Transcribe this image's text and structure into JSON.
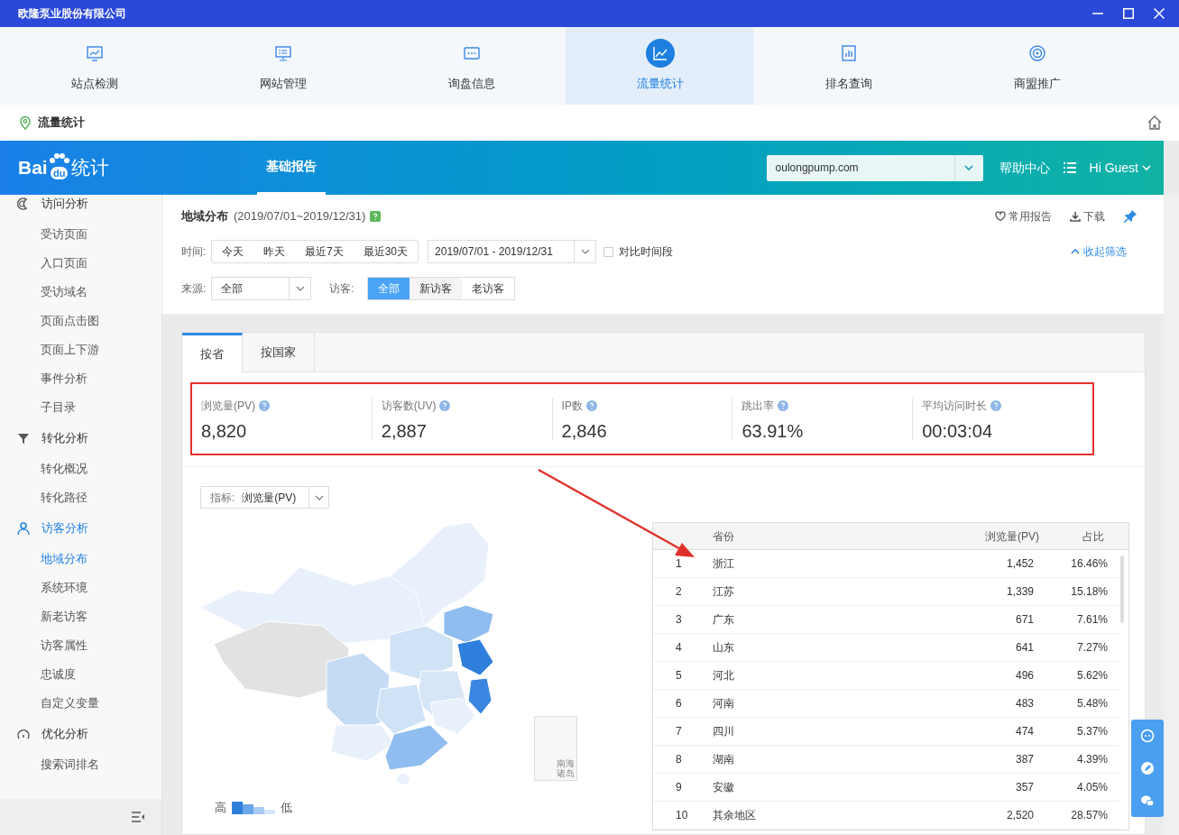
{
  "window": {
    "title": "欧隆泵业股份有限公司"
  },
  "nav_tabs": [
    {
      "label": "站点检测",
      "selected": false
    },
    {
      "label": "网站管理",
      "selected": false
    },
    {
      "label": "询盘信息",
      "selected": false
    },
    {
      "label": "流量统计",
      "selected": true
    },
    {
      "label": "排名查询",
      "selected": false
    },
    {
      "label": "商盟推广",
      "selected": false
    }
  ],
  "breadcrumb": "流量统计",
  "header": {
    "logo": {
      "left": "Bai",
      "paw": "du",
      "right": "统计"
    },
    "tabs": [
      {
        "label": "基础报告",
        "selected": true
      }
    ],
    "site_select": "oulongpump.com",
    "help": "帮助中心",
    "user": "Hi Guest"
  },
  "sidebar": {
    "groups": [
      {
        "label": "访问分析",
        "selected": false,
        "children": [
          {
            "label": "受访页面",
            "selected": false
          },
          {
            "label": "入口页面",
            "selected": false
          },
          {
            "label": "受访域名",
            "selected": false
          },
          {
            "label": "页面点击图",
            "selected": false
          },
          {
            "label": "页面上下游",
            "selected": false
          },
          {
            "label": "事件分析",
            "selected": false
          },
          {
            "label": "子目录",
            "selected": false
          }
        ]
      },
      {
        "label": "转化分析",
        "selected": false,
        "children": [
          {
            "label": "转化概况",
            "selected": false
          },
          {
            "label": "转化路径",
            "selected": false
          }
        ]
      },
      {
        "label": "访客分析",
        "selected": true,
        "children": [
          {
            "label": "地域分布",
            "selected": true
          },
          {
            "label": "系统环境",
            "selected": false
          },
          {
            "label": "新老访客",
            "selected": false
          },
          {
            "label": "访客属性",
            "selected": false
          },
          {
            "label": "忠诚度",
            "selected": false
          },
          {
            "label": "自定义变量",
            "selected": false
          }
        ]
      },
      {
        "label": "优化分析",
        "selected": false,
        "children": [
          {
            "label": "搜索词排名",
            "selected": false
          }
        ]
      }
    ]
  },
  "report": {
    "title": "地域分布",
    "date_range": "(2019/07/01~2019/12/31)",
    "actions": [
      "常用报告",
      "下载"
    ],
    "time_label": "时间:",
    "time_buttons": [
      "今天",
      "昨天",
      "最近7天",
      "最近30天"
    ],
    "date_input": "2019/07/01 - 2019/12/31",
    "compare": {
      "label": "对比时间段",
      "checked": false
    },
    "collapse": "收起筛选",
    "source_label": "来源:",
    "source_select": "全部",
    "visitor_label": "访客:",
    "visitor_buttons": [
      {
        "label": "全部",
        "selected": true
      },
      {
        "label": "新访客",
        "selected": false
      },
      {
        "label": "老访客",
        "selected": false
      }
    ]
  },
  "region_tabs": [
    {
      "label": "按省",
      "selected": true
    },
    {
      "label": "按国家",
      "selected": false
    }
  ],
  "metrics": [
    {
      "label": "浏览量(PV)",
      "value": "8,820"
    },
    {
      "label": "访客数(UV)",
      "value": "2,887"
    },
    {
      "label": "IP数",
      "value": "2,846"
    },
    {
      "label": "跳出率",
      "value": "63.91%"
    },
    {
      "label": "平均访问时长",
      "value": "00:03:04"
    }
  ],
  "indicator": {
    "label": "指标:",
    "value": "浏览量(PV)"
  },
  "map": {
    "inset_label": "南海诸岛",
    "legend_high": "高",
    "legend_low": "低"
  },
  "table": {
    "columns": [
      "省份",
      "浏览量(PV)",
      "占比"
    ],
    "rows": [
      {
        "rank": "1",
        "province": "浙江",
        "pv": "1,452",
        "share": "16.46%"
      },
      {
        "rank": "2",
        "province": "江苏",
        "pv": "1,339",
        "share": "15.18%"
      },
      {
        "rank": "3",
        "province": "广东",
        "pv": "671",
        "share": "7.61%"
      },
      {
        "rank": "4",
        "province": "山东",
        "pv": "641",
        "share": "7.27%"
      },
      {
        "rank": "5",
        "province": "河北",
        "pv": "496",
        "share": "5.62%"
      },
      {
        "rank": "6",
        "province": "河南",
        "pv": "483",
        "share": "5.48%"
      },
      {
        "rank": "7",
        "province": "四川",
        "pv": "474",
        "share": "5.37%"
      },
      {
        "rank": "8",
        "province": "湖南",
        "pv": "387",
        "share": "4.39%"
      },
      {
        "rank": "9",
        "province": "安徽",
        "pv": "357",
        "share": "4.05%"
      },
      {
        "rank": "10",
        "province": "其余地区",
        "pv": "2,520",
        "share": "28.57%"
      }
    ]
  }
}
